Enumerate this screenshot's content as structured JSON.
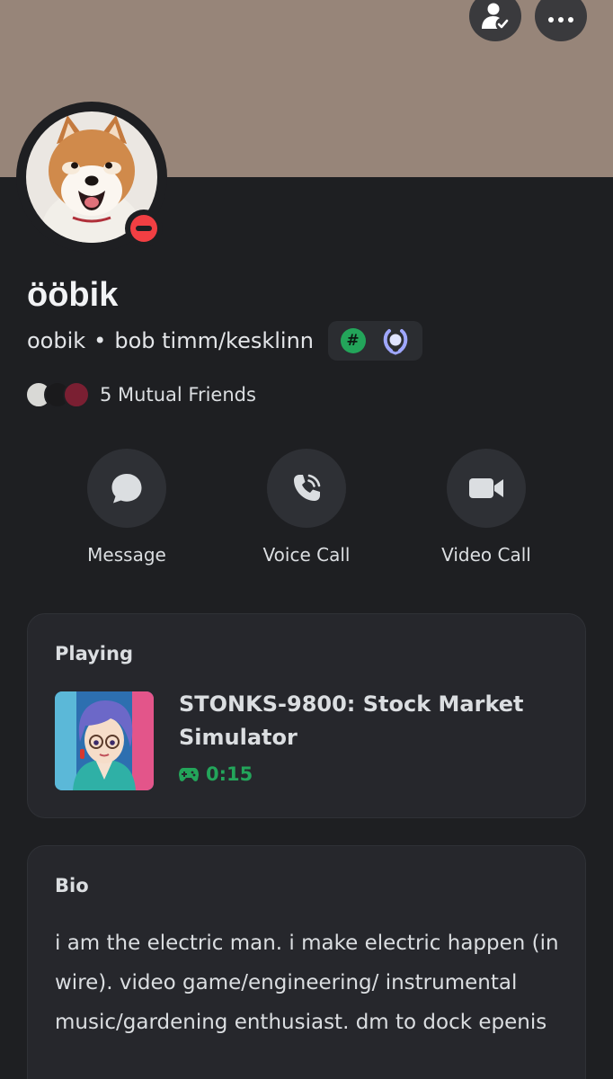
{
  "banner": {
    "color": "#978579"
  },
  "header": {
    "friend_icon": "person-check-icon",
    "more_icon": "more-dots-icon"
  },
  "profile": {
    "display_name": "ööbik",
    "username": "oobik",
    "separator": "•",
    "pronouns": "bob timm/kesklinn",
    "status": "do-not-disturb",
    "badges": [
      {
        "icon": "hashtag-badge-icon",
        "glyph": "#"
      },
      {
        "icon": "laurel-badge-icon"
      }
    ]
  },
  "mutual": {
    "text": "5 Mutual Friends"
  },
  "actions": [
    {
      "label": "Message",
      "icon": "chat-bubble-icon"
    },
    {
      "label": "Voice Call",
      "icon": "phone-icon"
    },
    {
      "label": "Video Call",
      "icon": "video-camera-icon"
    }
  ],
  "playing": {
    "heading": "Playing",
    "game_title": "STONKS-9800: Stock Market Simulator",
    "elapsed": "0:15",
    "elapsed_icon": "gamepad-icon"
  },
  "bio": {
    "heading": "Bio",
    "text": "i am the electric man. i make electric happen (in wire). video game/engineering/ instrumental music/gardening enthusiast. dm to dock epenis"
  },
  "colors": {
    "background": "#1e1f22",
    "card": "#26272c",
    "accent_green": "#23a55a",
    "dnd_red": "#f23f43"
  }
}
